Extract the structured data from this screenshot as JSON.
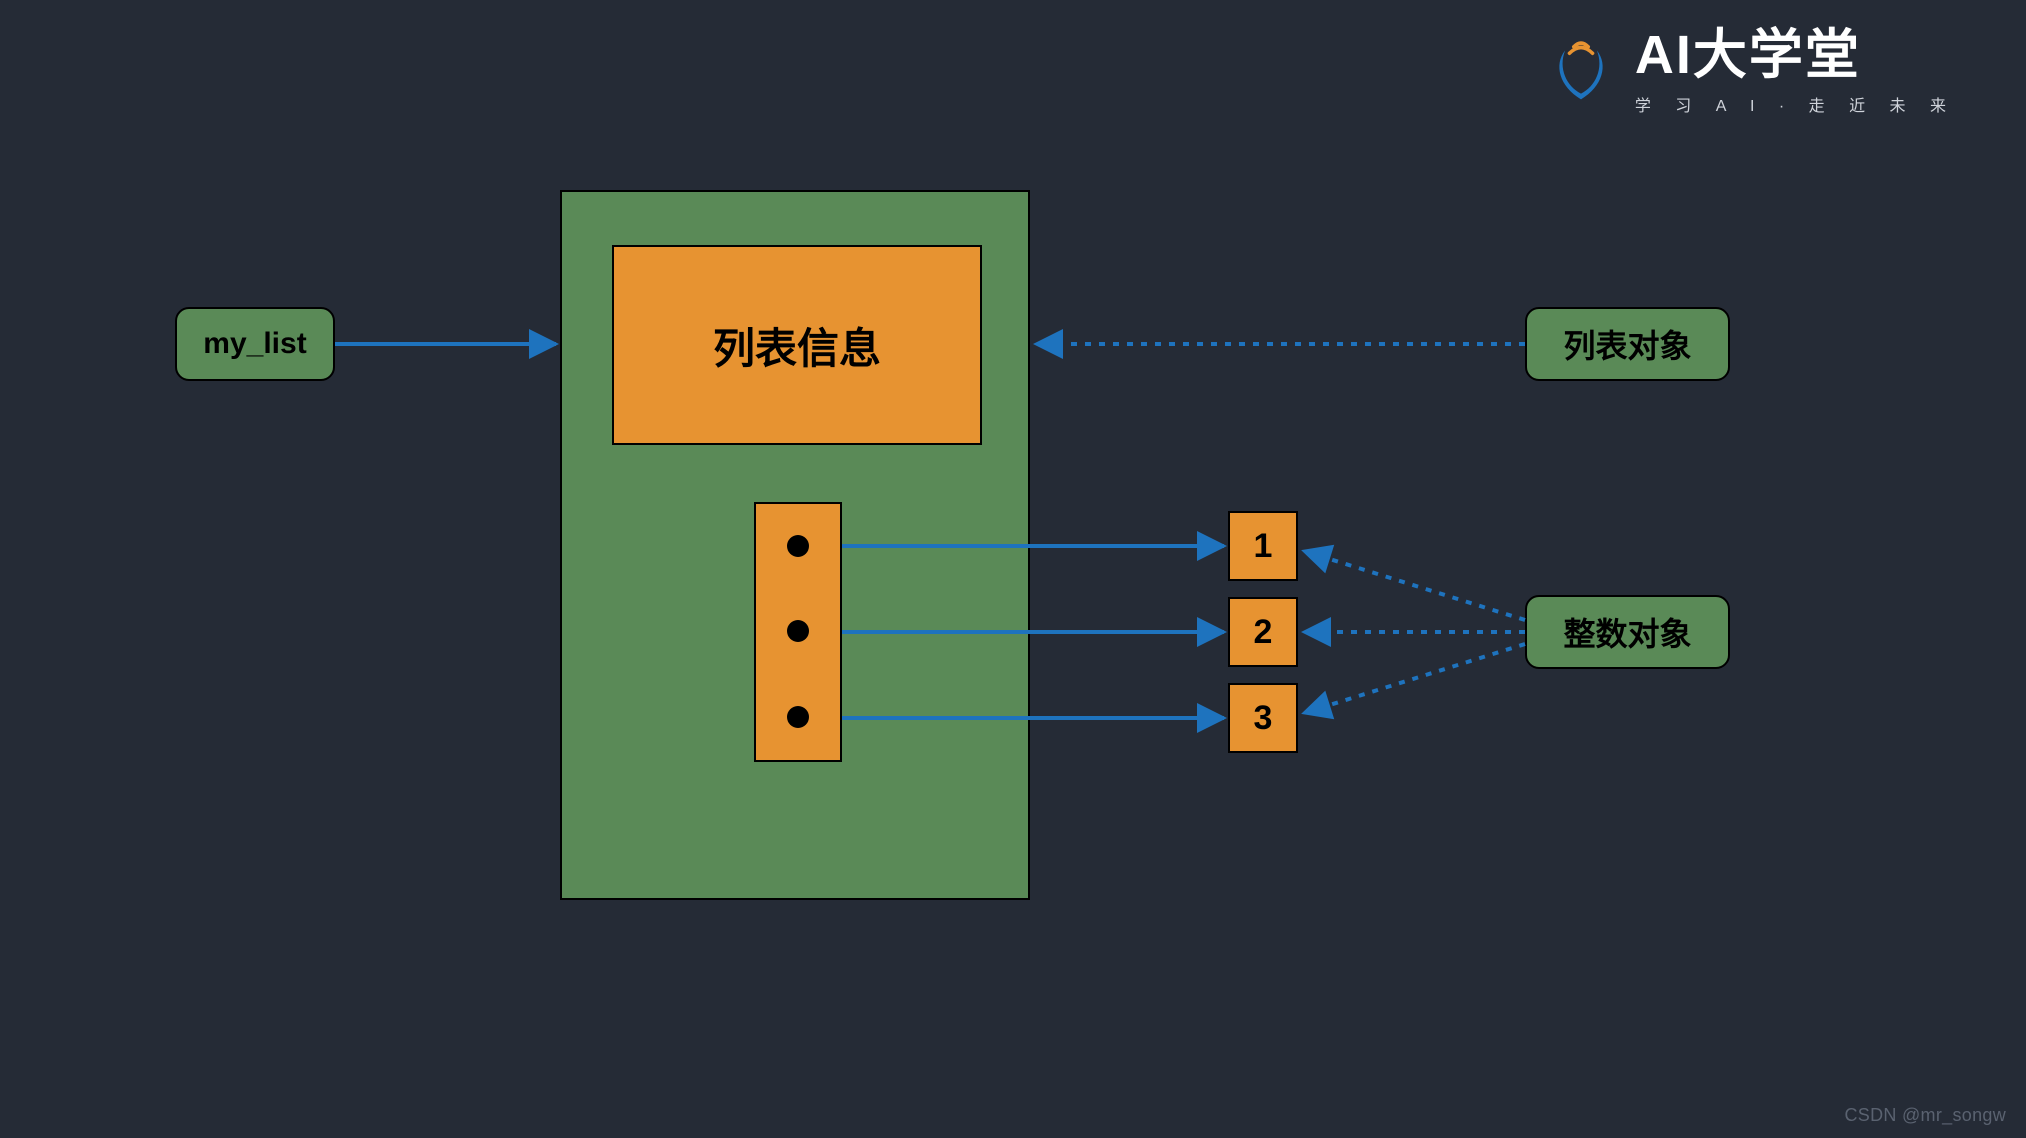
{
  "logo": {
    "title": "AI大学堂",
    "subtitle": "学 习 A I · 走 近 未 来"
  },
  "variable": {
    "label": "my_list"
  },
  "list_box": {
    "header": "列表信息"
  },
  "annotations": {
    "list_object": "列表对象",
    "int_object": "整数对象"
  },
  "integers": [
    "1",
    "2",
    "3"
  ],
  "watermark": "CSDN @mr_songw",
  "colors": {
    "background": "#252B36",
    "green": "#5A8A57",
    "orange": "#E79331",
    "arrow": "#1E73BE"
  }
}
